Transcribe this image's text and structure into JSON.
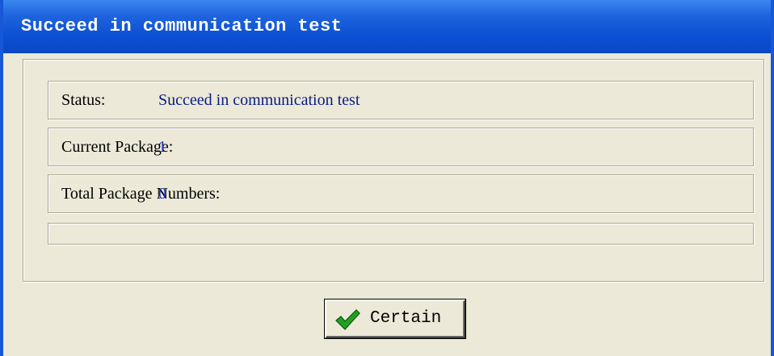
{
  "window": {
    "title": "Succeed in communication test"
  },
  "status": {
    "label": "Status:",
    "value": "Succeed in communication test"
  },
  "current_package": {
    "label": "Current Package:",
    "value": "1"
  },
  "total_packages": {
    "label": "Total Package Numbers:",
    "value": "0"
  },
  "progress": {
    "fraction": 0
  },
  "buttons": {
    "certain_label": "Certain",
    "certain_icon": "green-checkmark-icon"
  },
  "colors": {
    "titlebar": "#0b4fd3",
    "value_text": "#0a1c82",
    "dialog_bg": "#ece9d8",
    "check": "#1a9a1a"
  }
}
